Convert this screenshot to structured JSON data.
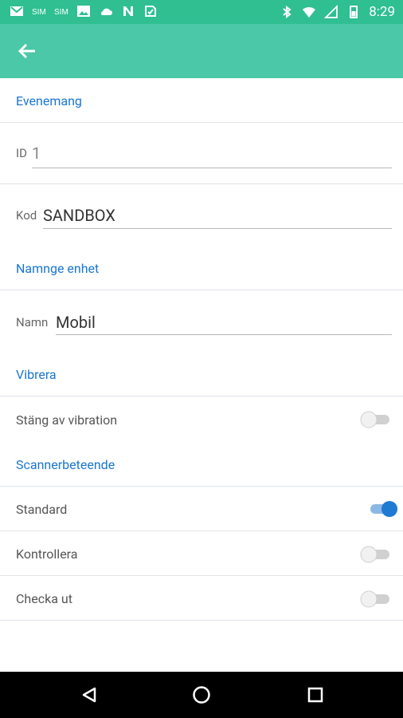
{
  "status": {
    "time": "8:29"
  },
  "sections": {
    "evenemang": "Evenemang",
    "namnge_enhet": "Namnge enhet",
    "vibrera": "Vibrera",
    "scannerbeteende": "Scannerbeteende"
  },
  "fields": {
    "id": {
      "label": "ID",
      "value": "1"
    },
    "kod": {
      "label": "Kod",
      "value": "SANDBOX"
    },
    "namn": {
      "label": "Namn",
      "value": "Mobil"
    }
  },
  "settings": {
    "vibration_label": "Stäng av vibration",
    "standard_label": "Standard",
    "kontrollera_label": "Kontrollera",
    "checka_ut_label": "Checka ut"
  },
  "toggles": {
    "vibration": "off",
    "standard": "on",
    "kontrollera": "off",
    "checka_ut": "off"
  }
}
